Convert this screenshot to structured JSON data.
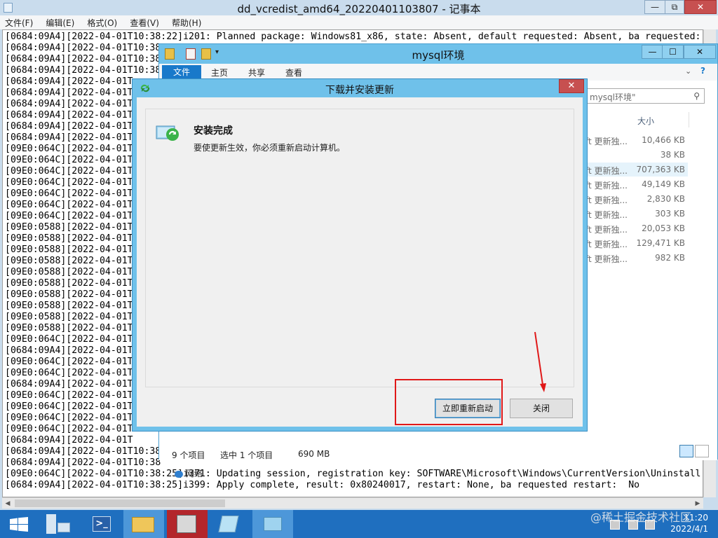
{
  "notepad": {
    "title": "dd_vcredist_amd64_20220401103807 - 记事本",
    "window_controls": {
      "minimize": "—",
      "restore": "⧉",
      "close": "✕"
    },
    "menu": [
      "文件(F)",
      "编辑(E)",
      "格式(O)",
      "查看(V)",
      "帮助(H)"
    ],
    "lines": [
      "[0684:09A4][2022-04-01T10:38:22]i201: Planned package: Windows81_x86, state: Absent, default requested: Absent, ba requested:",
      "[0684:09A4][2022-04-01T10:38",
      "[0684:09A4][2022-04-01T10:38",
      "[0684:09A4][2022-04-01T10:38",
      "[0684:09A4][2022-04-01T",
      "[0684:09A4][2022-04-01T",
      "[0684:09A4][2022-04-01T",
      "[0684:09A4][2022-04-01T",
      "[0684:09A4][2022-04-01T",
      "[0684:09A4][2022-04-01T",
      "[09E0:064C][2022-04-01T",
      "[09E0:064C][2022-04-01T",
      "[09E0:064C][2022-04-01T",
      "[09E0:064C][2022-04-01T",
      "[09E0:064C][2022-04-01T",
      "[09E0:064C][2022-04-01T",
      "[09E0:064C][2022-04-01T",
      "[09E0:0588][2022-04-01T",
      "[09E0:0588][2022-04-01T",
      "[09E0:0588][2022-04-01T",
      "[09E0:0588][2022-04-01T",
      "[09E0:0588][2022-04-01T",
      "[09E0:0588][2022-04-01T",
      "[09E0:0588][2022-04-01T",
      "[09E0:0588][2022-04-01T",
      "[09E0:0588][2022-04-01T",
      "[09E0:0588][2022-04-01T",
      "[09E0:064C][2022-04-01T",
      "[0684:09A4][2022-04-01T",
      "[09E0:064C][2022-04-01T",
      "[09E0:064C][2022-04-01T",
      "[0684:09A4][2022-04-01T",
      "[09E0:064C][2022-04-01T",
      "[09E0:064C][2022-04-01T",
      "[09E0:064C][2022-04-01T",
      "[09E0:064C][2022-04-01T",
      "[0684:09A4][2022-04-01T",
      "[0684:09A4][2022-04-01T10:38",
      "[0684:09A4][2022-04-01T10:38",
      "[09E0:064C][2022-04-01T10:38:25]i371: Updating session, registration key: SOFTWARE\\Microsoft\\Windows\\CurrentVersion\\Uninstall",
      "[0684:09A4][2022-04-01T10:38:25]i399: Apply complete, result: 0x80240017, restart: None, ba requested restart:  No"
    ]
  },
  "explorer": {
    "title": "mysql环境",
    "window_controls": {
      "minimize": "—",
      "maximize": "☐",
      "close": "✕"
    },
    "tabs": [
      "文件",
      "主页",
      "共享",
      "查看"
    ],
    "search_placeholder": "mysql环境\"",
    "column_size": "大小",
    "rows": [
      {
        "type": "ft 更新独...",
        "size": "10,466 KB"
      },
      {
        "type": "",
        "size": "38 KB"
      },
      {
        "type": "ft 更新独...",
        "size": "707,363 KB"
      },
      {
        "type": "ft 更新独...",
        "size": "49,149 KB"
      },
      {
        "type": "ft 更新独...",
        "size": "2,830 KB"
      },
      {
        "type": "ft 更新独...",
        "size": "303 KB"
      },
      {
        "type": "ft 更新独...",
        "size": "20,053 KB"
      },
      {
        "type": "ft 更新独...",
        "size": "129,471 KB"
      },
      {
        "type": "ft 更新独...",
        "size": "982 KB"
      }
    ],
    "nav_network": "网络",
    "status_items": "9 个项目",
    "status_selected": "选中 1 个项目",
    "status_size": "690 MB"
  },
  "dialog": {
    "title": "下载并安装更新",
    "close": "✕",
    "heading": "安装完成",
    "message": "要使更新生效，你必须重新启动计算机。",
    "restart_button": "立即重新启动",
    "close_button": "关闭"
  },
  "taskbar": {
    "time": "11:20",
    "date": "2022/4/1"
  },
  "watermark": "@稀土掘金技术社区",
  "colors": {
    "accent_blue": "#1979ca",
    "dialog_frame": "#6fc1ea",
    "annotation_red": "#e01818",
    "taskbar": "#1f6fbf"
  }
}
